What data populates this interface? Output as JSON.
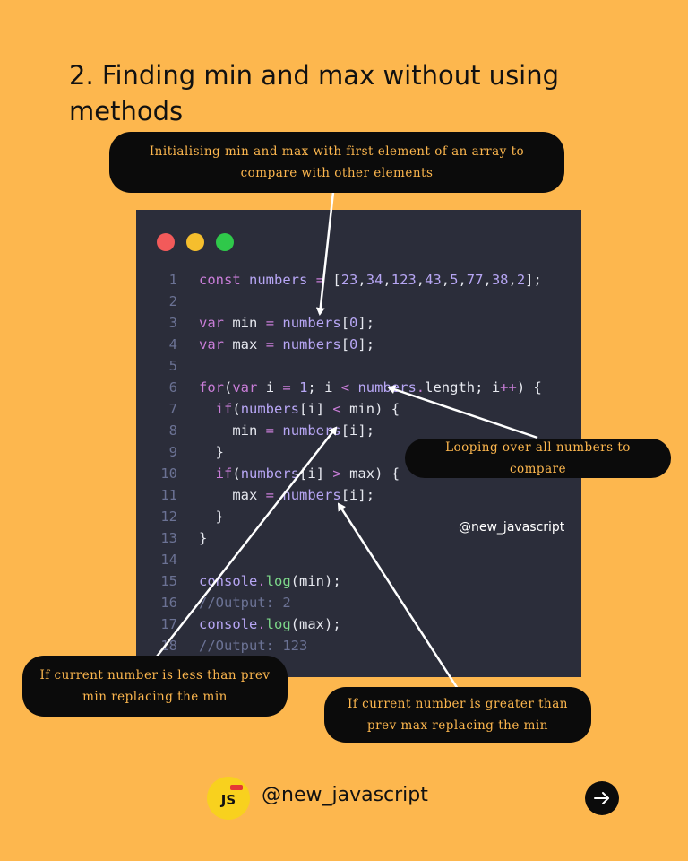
{
  "title": {
    "line1": "2. Finding min and max without using",
    "line2": "methods"
  },
  "window_controls": {
    "close_color": "#F25A5A",
    "minimize_color": "#F5BE2D",
    "maximize_color": "#2FC84A"
  },
  "code_lines": [
    {
      "n": "1",
      "text": "const numbers = [23,34,123,43,5,77,38,2];"
    },
    {
      "n": "2",
      "text": ""
    },
    {
      "n": "3",
      "text": "var min = numbers[0];"
    },
    {
      "n": "4",
      "text": "var max = numbers[0];"
    },
    {
      "n": "5",
      "text": ""
    },
    {
      "n": "6",
      "text": "for(var i = 1; i < numbers.length; i++) {"
    },
    {
      "n": "7",
      "text": "  if(numbers[i] < min) {"
    },
    {
      "n": "8",
      "text": "    min = numbers[i];"
    },
    {
      "n": "9",
      "text": "  }"
    },
    {
      "n": "10",
      "text": "  if(numbers[i] > max) {"
    },
    {
      "n": "11",
      "text": "    max = numbers[i];"
    },
    {
      "n": "12",
      "text": "  }"
    },
    {
      "n": "13",
      "text": "}"
    },
    {
      "n": "14",
      "text": ""
    },
    {
      "n": "15",
      "text": "console.log(min);"
    },
    {
      "n": "16",
      "text": "//Output: 2"
    },
    {
      "n": "17",
      "text": "console.log(max);"
    },
    {
      "n": "18",
      "text": "//Output: 123"
    }
  ],
  "watermark": "@new_javascript",
  "callouts": {
    "init": {
      "line1": "Initialising min and max with first element of an array to",
      "line2": "compare with other elements"
    },
    "loop": {
      "line1": "Looping over all numbers to compare"
    },
    "less": {
      "line1": "If current number is less than prev",
      "line2": "min  replacing the min"
    },
    "greater": {
      "line1": "If current number is greater than",
      "line2": "prev max  replacing the min"
    }
  },
  "footer": {
    "logo_text": "JS",
    "handle": "@new_javascript",
    "next_icon": "arrow-right-icon"
  }
}
